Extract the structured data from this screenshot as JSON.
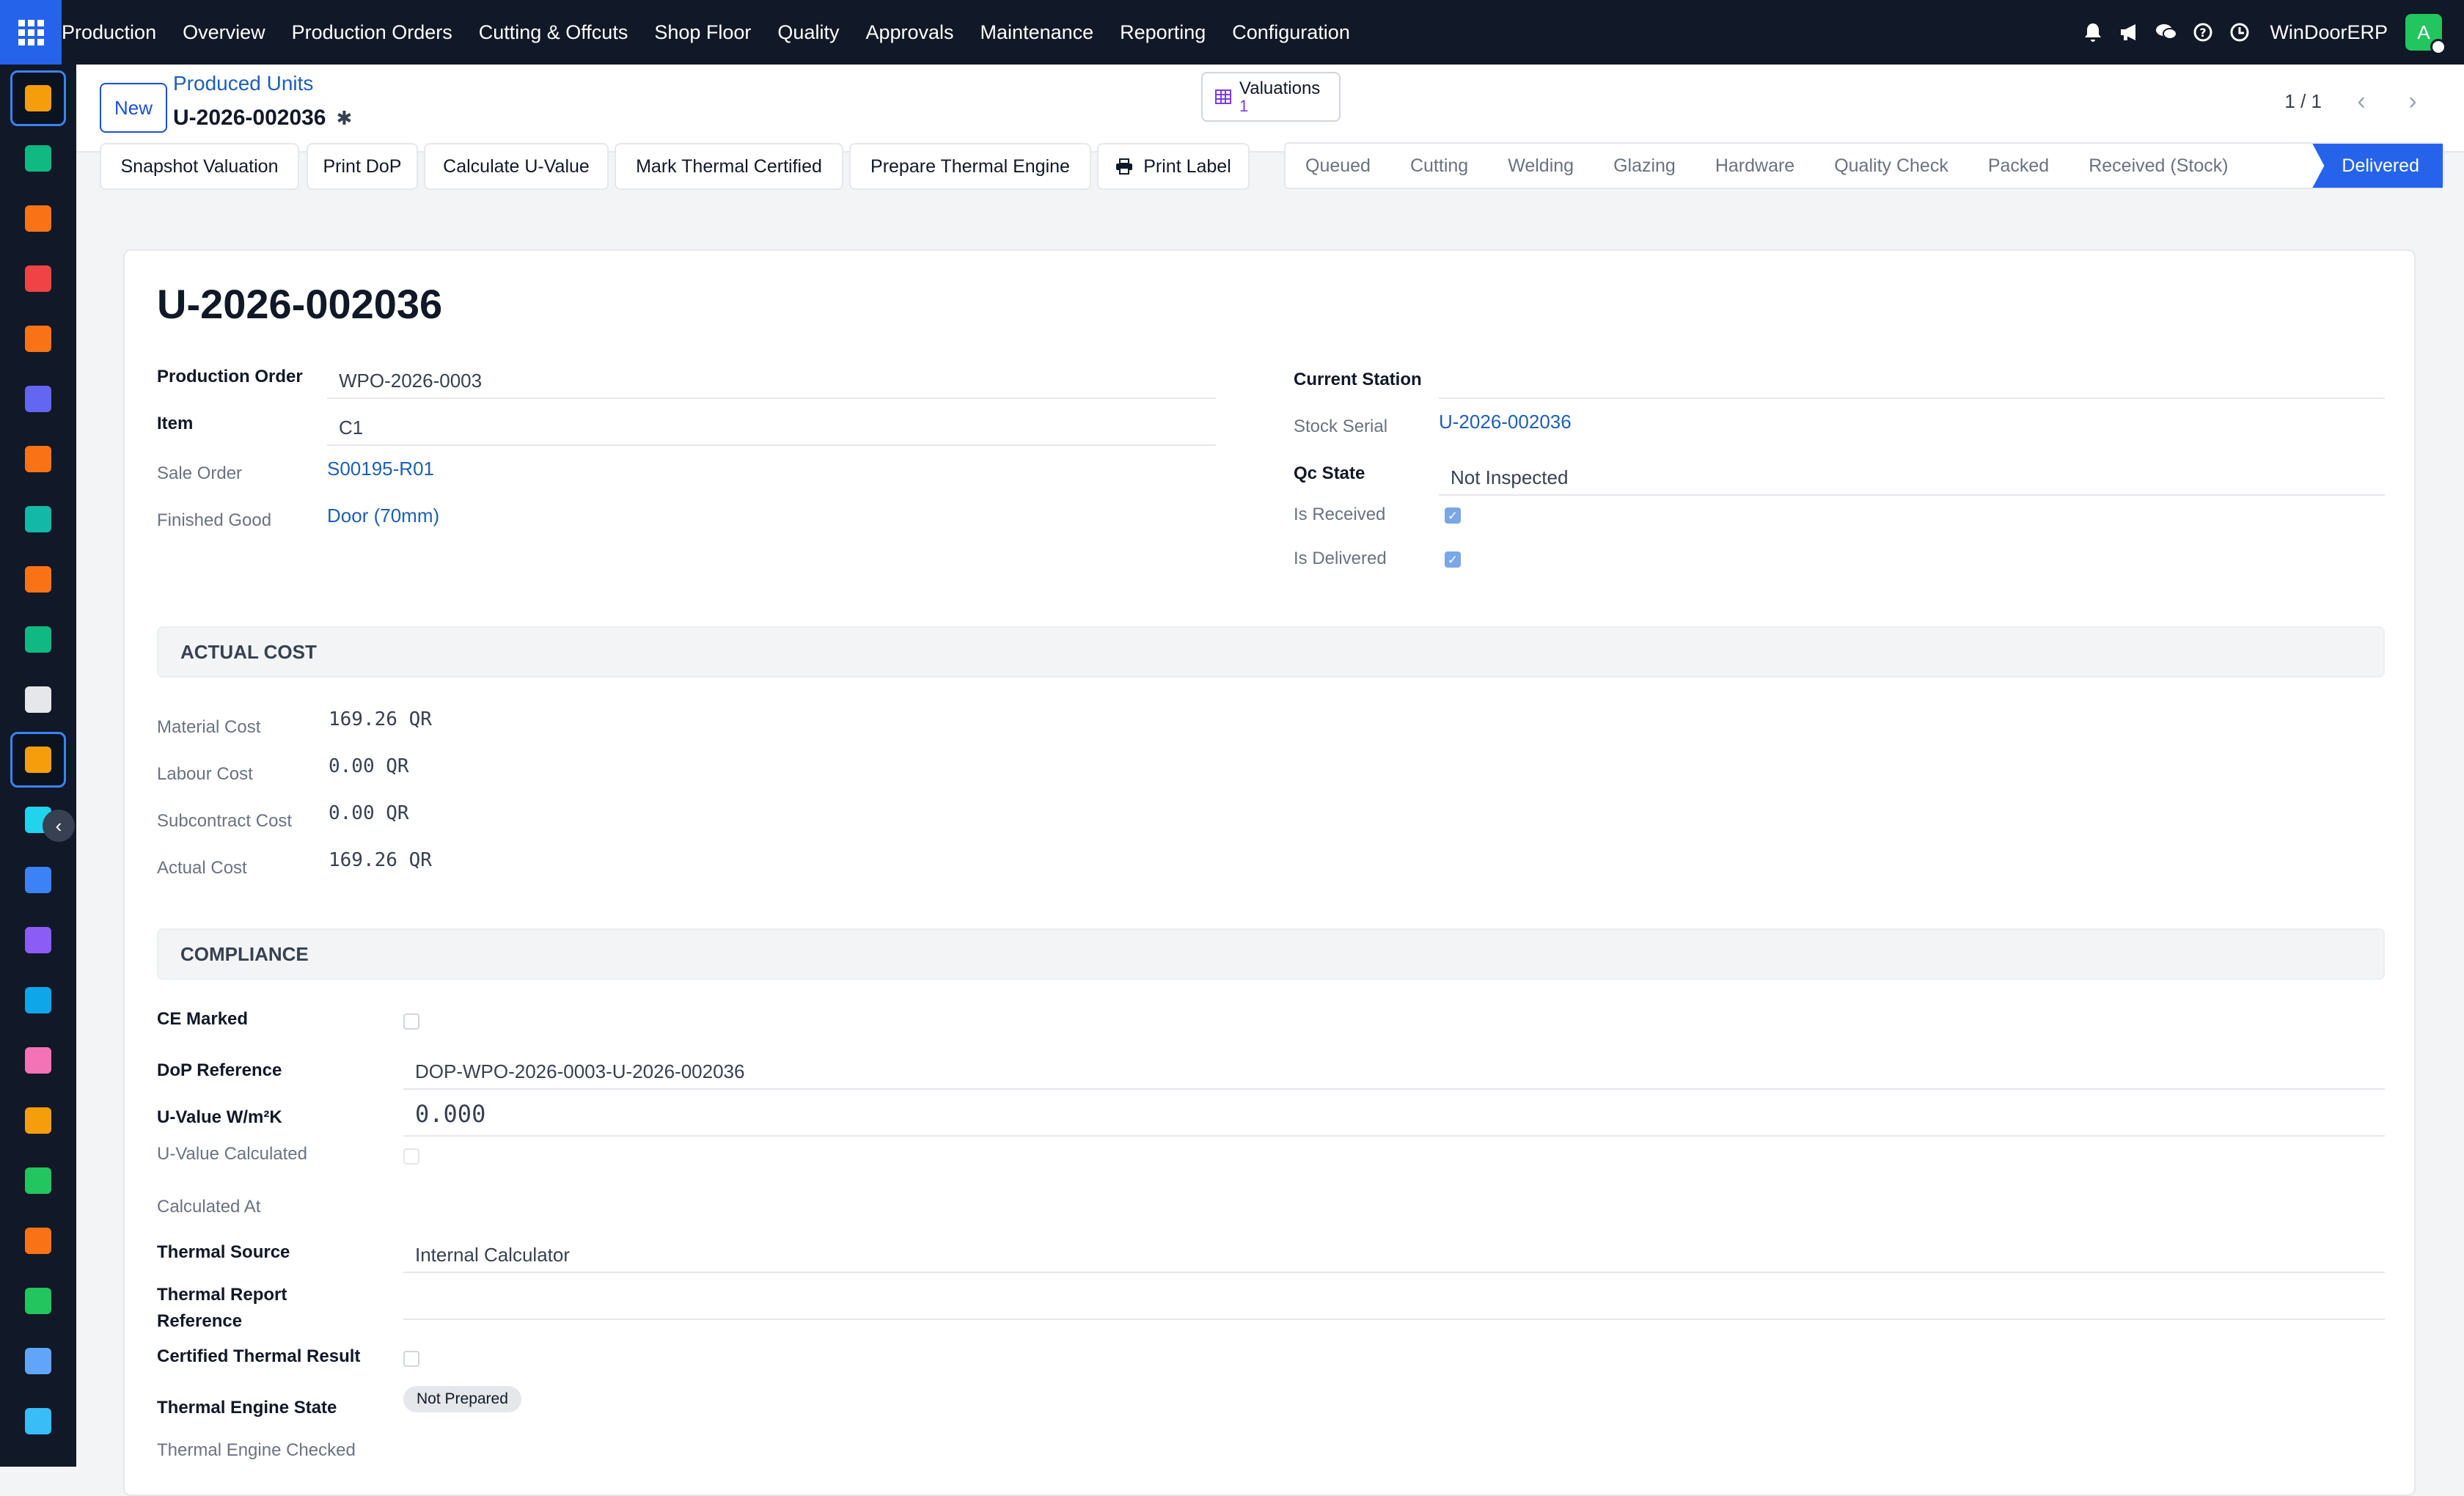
{
  "topbar": {
    "menu": [
      "Production",
      "Overview",
      "Production Orders",
      "Cutting & Offcuts",
      "Shop Floor",
      "Quality",
      "Approvals",
      "Maintenance",
      "Reporting",
      "Configuration"
    ],
    "company": "WinDoorERP",
    "avatar_letter": "A",
    "icons": [
      "bell-icon",
      "megaphone-icon",
      "chat-icon",
      "help-icon",
      "clock-icon"
    ]
  },
  "sidebar": {
    "items": [
      {
        "name": "production",
        "color": "#f59e0b"
      },
      {
        "name": "contacts",
        "color": "#10b981"
      },
      {
        "name": "reporting",
        "color": "#f97316"
      },
      {
        "name": "discuss",
        "color": "#ef4444"
      },
      {
        "name": "live-chat",
        "color": "#f97316"
      },
      {
        "name": "email-marketing",
        "color": "#6366f1"
      },
      {
        "name": "helpdesk",
        "color": "#f97316"
      },
      {
        "name": "planning",
        "color": "#14b8a6"
      },
      {
        "name": "dashboard",
        "color": "#f97316"
      },
      {
        "name": "employees",
        "color": "#10b981"
      },
      {
        "name": "inventory",
        "color": "#e5e7eb"
      },
      {
        "name": "manufacturing",
        "color": "#f59e0b"
      },
      {
        "name": "project",
        "color": "#22d3ee"
      },
      {
        "name": "knowledge",
        "color": "#3b82f6"
      },
      {
        "name": "purchase",
        "color": "#8b5cf6"
      },
      {
        "name": "invoicing",
        "color": "#0ea5e9"
      },
      {
        "name": "team",
        "color": "#f472b6"
      },
      {
        "name": "calendar",
        "color": "#f59e0b"
      },
      {
        "name": "sign",
        "color": "#22c55e"
      },
      {
        "name": "website",
        "color": "#f97316"
      },
      {
        "name": "whatsapp",
        "color": "#22c55e"
      },
      {
        "name": "timesheets",
        "color": "#60a5fa"
      },
      {
        "name": "apps",
        "color": "#38bdf8"
      }
    ]
  },
  "control": {
    "new_label": "New",
    "breadcrumb_parent": "Produced Units",
    "record_name": "U-2026-002036",
    "smart_label": "Valuations",
    "smart_count": "1",
    "pager": "1 / 1"
  },
  "actions": [
    "Snapshot Valuation",
    "Print DoP",
    "Calculate U-Value",
    "Mark Thermal Certified",
    "Prepare Thermal Engine",
    "Print Label"
  ],
  "stages": [
    "Queued",
    "Cutting",
    "Welding",
    "Glazing",
    "Hardware",
    "Quality Check",
    "Packed",
    "Received (Stock)",
    "Delivered"
  ],
  "current_stage": "Delivered",
  "form": {
    "title": "U-2026-002036",
    "production_order_label": "Production Order",
    "production_order": "WPO-2026-0003",
    "item_label": "Item",
    "item": "C1",
    "sale_order_label": "Sale Order",
    "sale_order": "S00195-R01",
    "finished_good_label": "Finished Good",
    "finished_good": "Door (70mm)",
    "current_station_label": "Current Station",
    "current_station": "",
    "stock_serial_label": "Stock Serial",
    "stock_serial": "U-2026-002036",
    "qc_state_label": "Qc State",
    "qc_state": "Not Inspected",
    "is_received_label": "Is Received",
    "is_received": true,
    "is_delivered_label": "Is Delivered",
    "is_delivered": true
  },
  "actual_cost": {
    "heading": "ACTUAL COST",
    "material_label": "Material Cost",
    "material": "169.26 QR",
    "labour_label": "Labour Cost",
    "labour": "0.00 QR",
    "subcontract_label": "Subcontract Cost",
    "subcontract": "0.00 QR",
    "actual_label": "Actual Cost",
    "actual": "169.26 QR"
  },
  "compliance": {
    "heading": "COMPLIANCE",
    "ce_marked_label": "CE Marked",
    "ce_marked": false,
    "dop_label": "DoP Reference",
    "dop": "DOP-WPO-2026-0003-U-2026-002036",
    "u_value_label": "U-Value W/m²K",
    "u_value": "0.000",
    "u_calc_label": "U-Value Calculated",
    "u_calc": false,
    "calc_at_label": "Calculated At",
    "thermal_source_label": "Thermal Source",
    "thermal_source": "Internal Calculator",
    "thermal_report_label_1": "Thermal Report",
    "thermal_report_label_2": "Reference",
    "certified_label": "Certified Thermal Result",
    "certified": false,
    "engine_state_label": "Thermal Engine State",
    "engine_state": "Not Prepared",
    "engine_checked_label": "Thermal Engine Checked"
  }
}
